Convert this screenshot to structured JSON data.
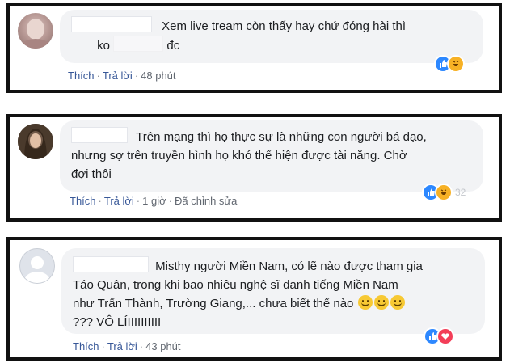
{
  "comments": [
    {
      "text_line1": "Xem live tream còn thấy hay chứ đóng hài thì",
      "text_line2a": "ko",
      "text_line2b": "đc",
      "like": "Thích",
      "reply": "Trả lời",
      "time": "48 phút",
      "reaction_icons": [
        "like-icon",
        "haha-icon"
      ],
      "reaction_count": "",
      "colors": {
        "like": "#2d88ff",
        "haha": "#f7b125"
      }
    },
    {
      "text_line1": "Trên mạng thì họ thực sự là những con người bá đạo,",
      "text_line2": "nhưng sợ trên truyền hình họ khó thể hiện được tài năng. Chờ",
      "text_line3": "đợi thôi",
      "like": "Thích",
      "reply": "Trả lời",
      "time": "1 giờ",
      "edited": "Đã chỉnh sửa",
      "reaction_icons": [
        "like-icon",
        "haha-icon"
      ],
      "reaction_count": "32"
    },
    {
      "text_line1": "Misthy người Miền Nam, có lẽ nào được tham gia",
      "text_line2": "Táo Quân, trong khi bao nhiêu nghệ sĩ danh tiếng Miền Nam",
      "text_line3": "như Trấn Thành, Trường Giang,... chưa biết thế nào",
      "text_line4": "??? VÔ LÍIIIIIIIIII",
      "emoji_icons": [
        "smile-emoji-icon",
        "smile-emoji-icon",
        "smile-emoji-icon"
      ],
      "like": "Thích",
      "reply": "Trả lời",
      "time": "43 phút",
      "reaction_icons": [
        "like-icon",
        "love-icon"
      ],
      "reaction_count": "",
      "colors": {
        "love": "#f33e58"
      }
    }
  ]
}
